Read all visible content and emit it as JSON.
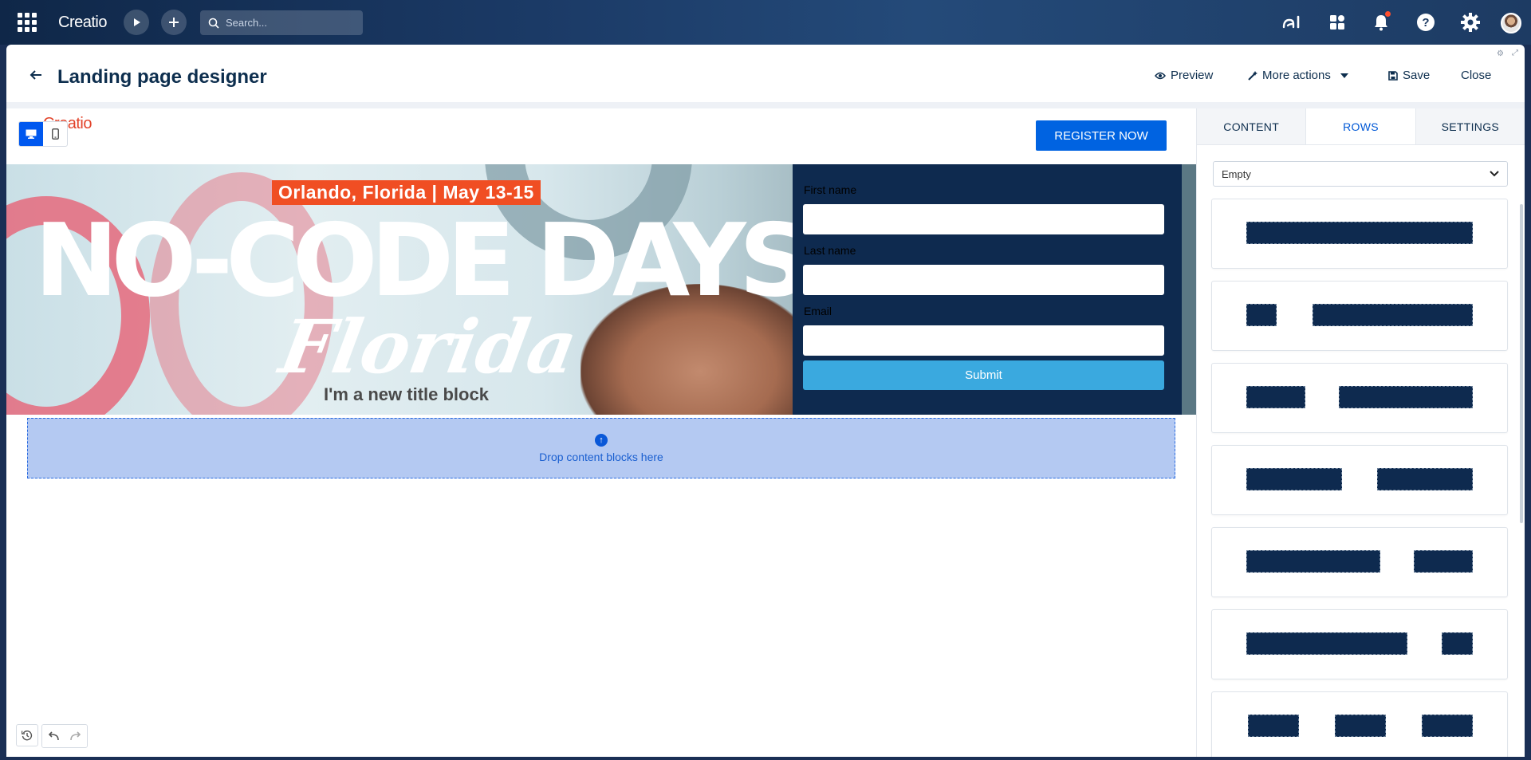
{
  "topbar": {
    "logo": "Creatio",
    "search_placeholder": "Search...",
    "icons": [
      "apps-grid-icon",
      "play-icon",
      "plus-icon",
      "search-icon",
      "ai-icon",
      "dashboard-icon",
      "bell-icon",
      "help-icon",
      "gear-icon",
      "avatar"
    ]
  },
  "header": {
    "title": "Landing page designer",
    "preview_label": "Preview",
    "more_actions_label": "More actions",
    "save_label": "Save",
    "close_label": "Close"
  },
  "canvas": {
    "logo_text": "Creatio",
    "register_label": "REGISTER NOW",
    "hero": {
      "date_banner": "Orlando, Florida | May 13-15",
      "title": "NO-CODE DAYS",
      "script": "Florida",
      "subtitle": "I'm a new title block"
    },
    "form": {
      "first_name_label": "First name",
      "last_name_label": "Last name",
      "email_label": "Email",
      "submit_label": "Submit"
    },
    "dropzone_text": "Drop content blocks here"
  },
  "side_panel": {
    "tabs": [
      {
        "label": "CONTENT",
        "active": false
      },
      {
        "label": "ROWS",
        "active": true
      },
      {
        "label": "SETTINGS",
        "active": false
      }
    ],
    "row_filter_value": "Empty"
  },
  "colors": {
    "accent": "#0058EF",
    "topbar": "#1B3A66",
    "form_panel": "#0E2A4F",
    "submit": "#3AA9DF",
    "date_banner": "#F04E23",
    "dropzone": "#B4C9F2"
  }
}
